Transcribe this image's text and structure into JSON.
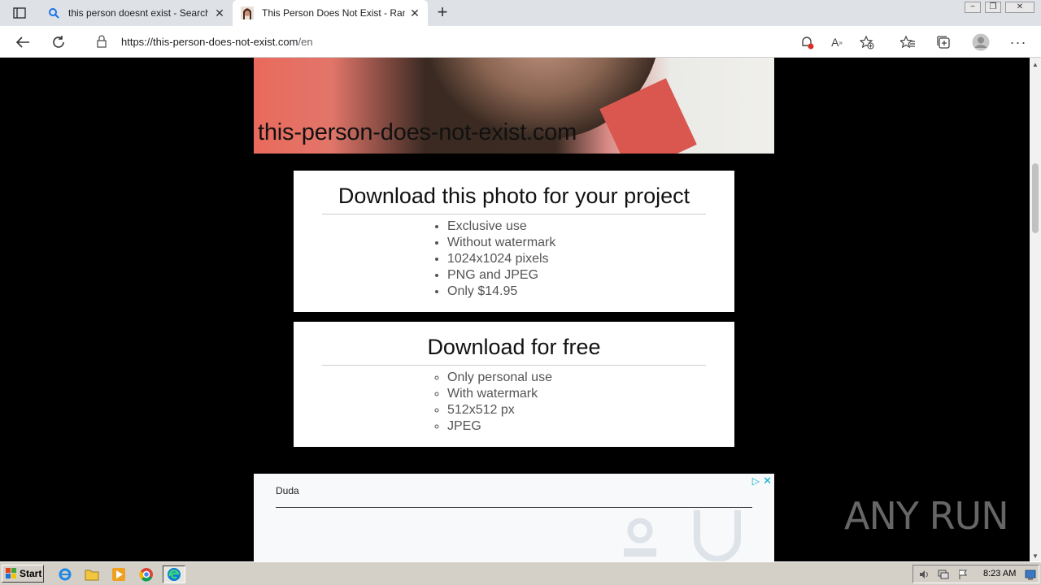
{
  "browser": {
    "tabs": [
      {
        "title": "this person doesnt exist - Search",
        "favicon": "search-icon",
        "active": false
      },
      {
        "title": "This Person Does Not Exist - Random Person Generator",
        "favicon": "portrait-favicon",
        "active": true
      }
    ],
    "url_host": "https://this-person-does-not-exist.com",
    "url_rest": "/en"
  },
  "page": {
    "photo_watermark": "this-person-does-not-exist.com",
    "paid_card": {
      "title": "Download this photo for your project",
      "items": [
        "Exclusive use",
        "Without watermark",
        "1024x1024 pixels",
        "PNG and JPEG",
        "Only $14.95"
      ]
    },
    "free_card": {
      "title": "Download for free",
      "items": [
        "Only personal use",
        "With watermark",
        "512x512 px",
        "JPEG"
      ]
    },
    "ad": {
      "brand": "Duda"
    }
  },
  "overlay": {
    "watermark_text": "ANY RUN"
  },
  "taskbar": {
    "start_label": "Start",
    "clock": "8:23 AM"
  },
  "colors": {
    "tab_strip": "#dee1e6",
    "page_background": "#000000",
    "card_background": "#ffffff",
    "taskbar": "#d4d0c8",
    "ad_accent": "#00aecd"
  }
}
